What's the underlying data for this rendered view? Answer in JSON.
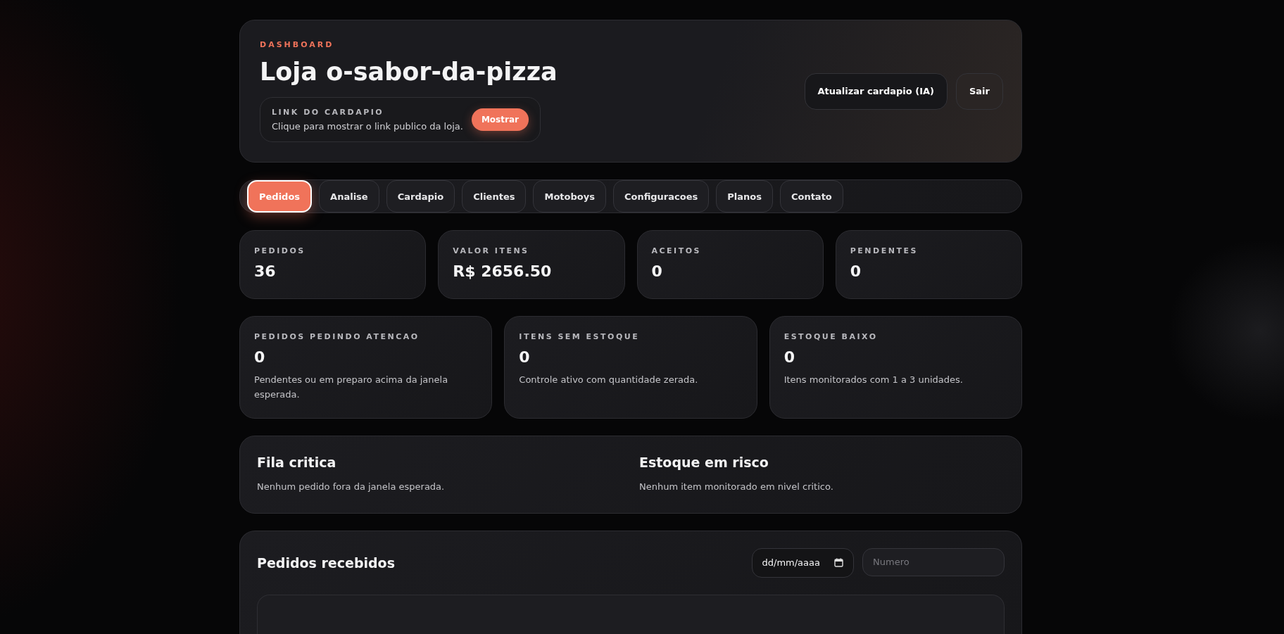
{
  "header": {
    "eyebrow": "DASHBOARD",
    "title": "Loja o-sabor-da-pizza",
    "link_box": {
      "label": "LINK DO CARDAPIO",
      "text": "Clique para mostrar o link publico da loja.",
      "button": "Mostrar"
    },
    "actions": [
      "Atualizar cardapio (IA)",
      "Sair"
    ]
  },
  "tabs": [
    {
      "label": "Pedidos",
      "selected": true
    },
    {
      "label": "Analise",
      "selected": false
    },
    {
      "label": "Cardapio",
      "selected": false
    },
    {
      "label": "Clientes",
      "selected": false
    },
    {
      "label": "Motoboys",
      "selected": false
    },
    {
      "label": "Configuracoes",
      "selected": false
    },
    {
      "label": "Planos",
      "selected": false
    },
    {
      "label": "Contato",
      "selected": false
    }
  ],
  "stats": [
    {
      "label": "PEDIDOS",
      "value": "36"
    },
    {
      "label": "VALOR ITENS",
      "value": "R$ 2656.50"
    },
    {
      "label": "ACEITOS",
      "value": "0"
    },
    {
      "label": "PENDENTES",
      "value": "0"
    }
  ],
  "alerts": [
    {
      "label": "PEDIDOS PEDINDO ATENCAO",
      "value": "0",
      "note": "Pendentes ou em preparo acima da janela esperada."
    },
    {
      "label": "ITENS SEM ESTOQUE",
      "value": "0",
      "note": "Controle ativo com quantidade zerada."
    },
    {
      "label": "ESTOQUE BAIXO",
      "value": "0",
      "note": "Itens monitorados com 1 a 3 unidades."
    }
  ],
  "panels": [
    {
      "title": "Fila critica",
      "text": "Nenhum pedido fora da janela esperada."
    },
    {
      "title": "Estoque em risco",
      "text": "Nenhum item monitorado em nivel critico."
    }
  ],
  "orders": {
    "title": "Pedidos recebidos",
    "date_value": "dd/mm/aaaa",
    "number_placeholder": "Numero"
  }
}
